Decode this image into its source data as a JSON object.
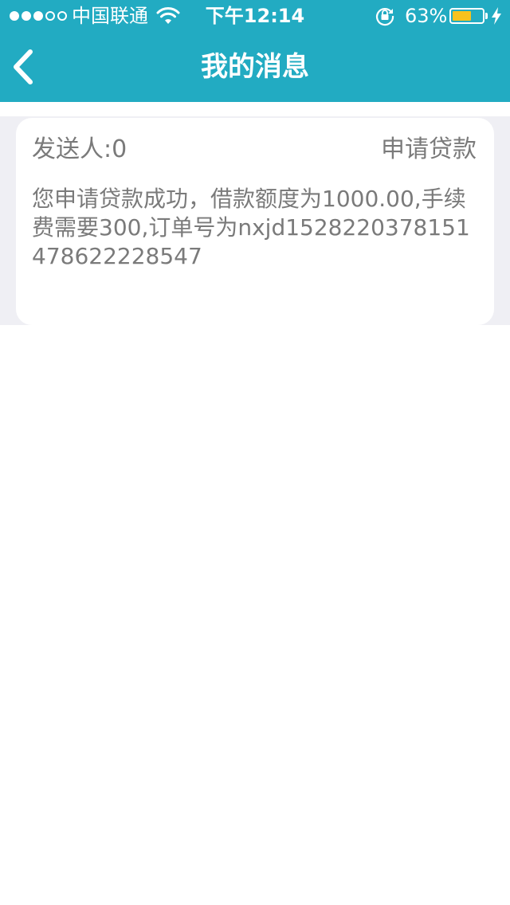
{
  "status_bar": {
    "carrier": "中国联通",
    "time": "下午12:14",
    "battery_percent": "63%",
    "battery_level": 0.63,
    "battery_color": "#f7c21d",
    "signal_bars_filled": 3,
    "signal_bars_total": 5
  },
  "nav": {
    "title": "我的消息",
    "back_icon": "chevron-left-icon"
  },
  "theme": {
    "header_color": "#22abc2",
    "page_background": "#efeff4",
    "text_color": "#7a7a7a"
  },
  "messages": [
    {
      "sender": "发送人:0",
      "type": "申请贷款",
      "body": "您申请贷款成功，借款额度为1000.00,手续费需要300,订单号为nxjd15282203781514786222​28547"
    }
  ]
}
